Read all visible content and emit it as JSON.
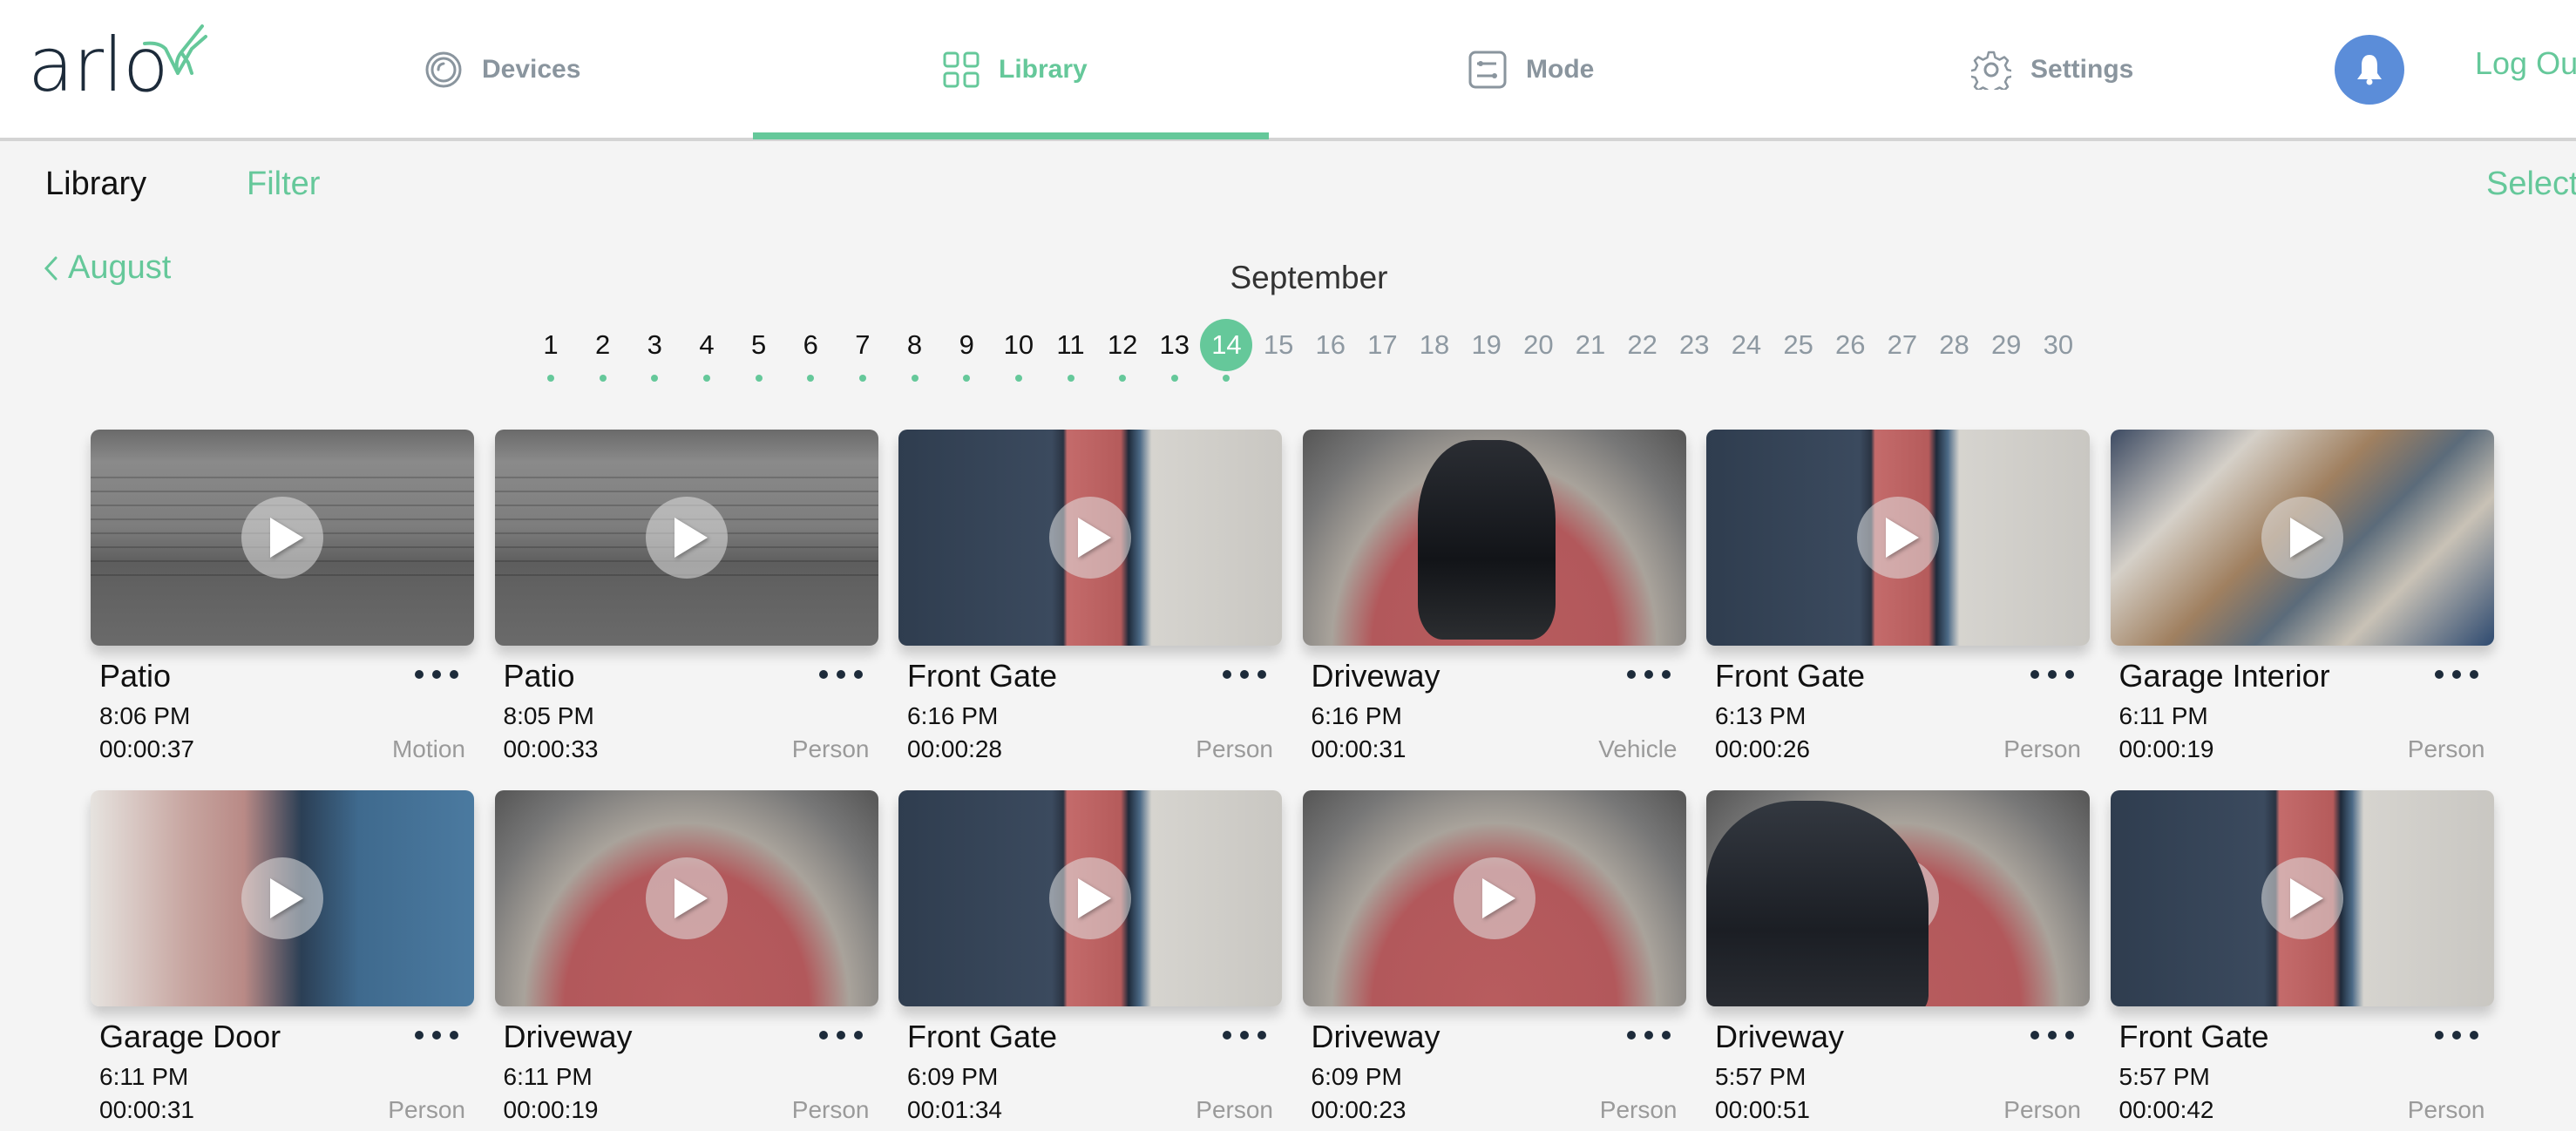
{
  "header": {
    "logo_text": "arlo",
    "nav": [
      {
        "label": "Devices",
        "icon": "devices-icon",
        "active": false
      },
      {
        "label": "Library",
        "icon": "library-grid-icon",
        "active": true
      },
      {
        "label": "Mode",
        "icon": "mode-sliders-icon",
        "active": false
      },
      {
        "label": "Settings",
        "icon": "gear-icon",
        "active": false
      }
    ],
    "notifications_icon": "bell-icon",
    "logout_label": "Log Out"
  },
  "subheader": {
    "title": "Library",
    "filter_label": "Filter",
    "select_label": "Select"
  },
  "calendar": {
    "prev_month_label": "August",
    "month": "September",
    "selected_day": 14,
    "days": [
      "1",
      "2",
      "3",
      "4",
      "5",
      "6",
      "7",
      "8",
      "9",
      "10",
      "11",
      "12",
      "13",
      "14",
      "15",
      "16",
      "17",
      "18",
      "19",
      "20",
      "21",
      "22",
      "23",
      "24",
      "25",
      "26",
      "27",
      "28",
      "29",
      "30"
    ],
    "days_with_recordings": [
      1,
      2,
      3,
      4,
      5,
      6,
      7,
      8,
      9,
      10,
      11,
      12,
      13,
      14
    ]
  },
  "colors": {
    "accent": "#65c89a",
    "bell": "#5b8dd9",
    "nav_inactive": "#8a959e",
    "tag_text": "#9a9a9a"
  },
  "recordings": [
    {
      "camera": "Patio",
      "time": "8:06 PM",
      "duration": "00:00:37",
      "tag": "Motion",
      "scene": "patio"
    },
    {
      "camera": "Patio",
      "time": "8:05 PM",
      "duration": "00:00:33",
      "tag": "Person",
      "scene": "patio"
    },
    {
      "camera": "Front Gate",
      "time": "6:16 PM",
      "duration": "00:00:28",
      "tag": "Person",
      "scene": "frontgate"
    },
    {
      "camera": "Driveway",
      "time": "6:16 PM",
      "duration": "00:00:31",
      "tag": "Vehicle",
      "scene": "driveway scene-car"
    },
    {
      "camera": "Front Gate",
      "time": "6:13 PM",
      "duration": "00:00:26",
      "tag": "Person",
      "scene": "frontgate"
    },
    {
      "camera": "Garage Interior",
      "time": "6:11 PM",
      "duration": "00:00:19",
      "tag": "Person",
      "scene": "garage"
    },
    {
      "camera": "Garage Door",
      "time": "6:11 PM",
      "duration": "00:00:31",
      "tag": "Person",
      "scene": "garagedoor"
    },
    {
      "camera": "Driveway",
      "time": "6:11 PM",
      "duration": "00:00:19",
      "tag": "Person",
      "scene": "driveway"
    },
    {
      "camera": "Front Gate",
      "time": "6:09 PM",
      "duration": "00:01:34",
      "tag": "Person",
      "scene": "frontgate"
    },
    {
      "camera": "Driveway",
      "time": "6:09 PM",
      "duration": "00:00:23",
      "tag": "Person",
      "scene": "driveway"
    },
    {
      "camera": "Driveway",
      "time": "5:57 PM",
      "duration": "00:00:51",
      "tag": "Person",
      "scene": "driveway scene-car2"
    },
    {
      "camera": "Front Gate",
      "time": "5:57 PM",
      "duration": "00:00:42",
      "tag": "Person",
      "scene": "frontgate"
    }
  ]
}
